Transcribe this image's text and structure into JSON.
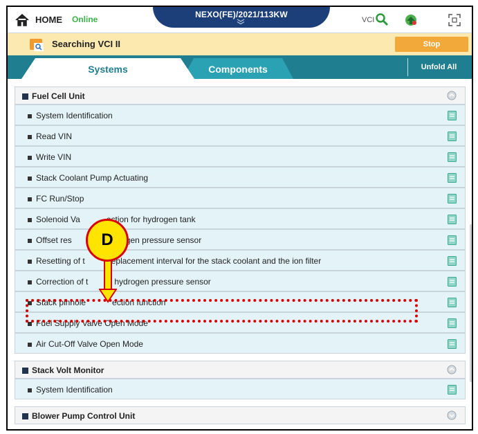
{
  "topbar": {
    "home_label": "HOME",
    "status": "Online",
    "vehicle": "NEXO(FE)/2021/113KW",
    "vci_label": "VCI"
  },
  "search": {
    "text": "Searching VCI II",
    "stop_label": "Stop"
  },
  "tabs": {
    "systems": "Systems",
    "components": "Components",
    "unfold_all": "Unfold All"
  },
  "groups": [
    {
      "title": "Fuel Cell Unit",
      "items": [
        "System Identification",
        "Read VIN",
        "Write VIN",
        "Stack Coolant Pump Actuating",
        "FC Run/Stop",
        "Solenoid Va",
        "Offset res",
        "Resetting of t",
        "Correction of t",
        "Stack pinhole",
        "Fuel Supply Valve Open Mode",
        "Air Cut-Off Valve Open Mode"
      ],
      "item_suffixes": [
        "",
        "",
        "",
        "",
        "",
        "ection for hydrogen tank",
        "e hydrogen pressure sensor",
        "eplacement interval for the stack coolant and the ion filter",
        "hydrogen pressure sensor",
        "ection function",
        "",
        ""
      ]
    },
    {
      "title": "Stack Volt Monitor",
      "items": [
        "System Identification"
      ]
    },
    {
      "title": "Blower Pump Control Unit",
      "items": []
    }
  ],
  "annotation": {
    "callout_letter": "D"
  },
  "colors": {
    "accent_teal": "#1f7e8f",
    "header_blue": "#1c3f7a",
    "stop_orange": "#f3a83a",
    "annotation_red": "#d90000",
    "callout_yellow": "#ffe400"
  },
  "icons": {
    "home": "home-icon",
    "search": "search-icon",
    "vci": "vci-device-icon",
    "expand": "expand-icon",
    "folder": "folder-search-icon",
    "doc": "document-icon",
    "collapse": "collapse-group-icon"
  }
}
